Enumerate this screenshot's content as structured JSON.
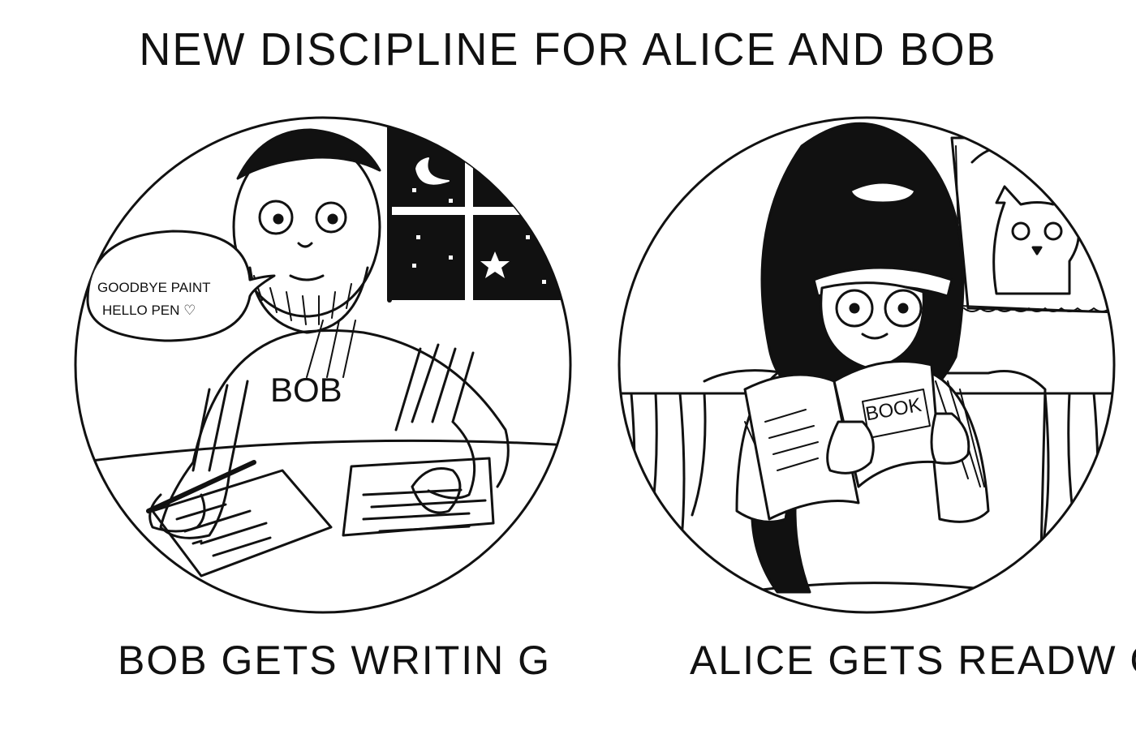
{
  "title": "NEW DISCIPLINE FOR ALICE AND BOB",
  "panels": [
    {
      "caption": "BOB GETS WRITIN G",
      "speech_bubble": {
        "line1": "GOODBYE PAINT",
        "line2": "HELLO PEN ♡"
      },
      "shirt_text": "BOB"
    },
    {
      "caption": "ALICE GETS READW G",
      "book_text": "BOOK"
    }
  ],
  "colors": {
    "ink": "#111111",
    "background": "#ffffff"
  },
  "icons": [
    "moon-icon",
    "star-icon",
    "heart-icon"
  ]
}
